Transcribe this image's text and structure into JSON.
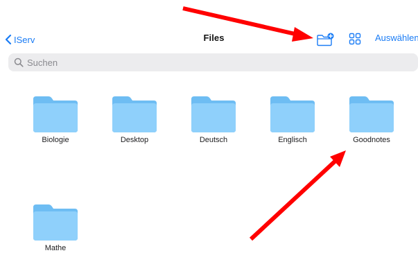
{
  "nav": {
    "back_label": "IServ",
    "title": "Files",
    "select_label": "Auswählen"
  },
  "search": {
    "placeholder": "Suchen",
    "value": ""
  },
  "folders": [
    {
      "name": "Biologie"
    },
    {
      "name": "Desktop"
    },
    {
      "name": "Deutsch"
    },
    {
      "name": "Englisch"
    },
    {
      "name": "Goodnotes"
    },
    {
      "name": "Mathe"
    }
  ],
  "icons": {
    "back": "chevron-left-icon",
    "new_folder": "folder-plus-icon",
    "view_toggle": "grid-icon",
    "search": "magnifier-icon",
    "folder": "folder-icon"
  },
  "colors": {
    "accent": "#1a7cf5",
    "folder_front": "#8fd0fb",
    "folder_back": "#6ebdf3",
    "search_bg": "#ececee",
    "annotation_arrow": "#ff0000"
  }
}
